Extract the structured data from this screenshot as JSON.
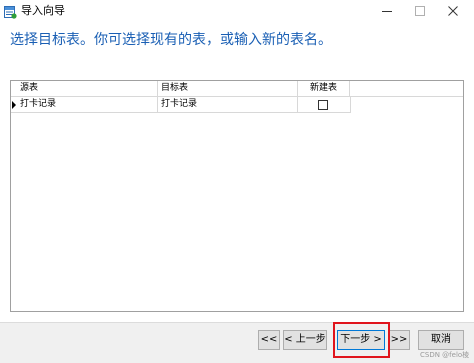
{
  "window": {
    "title": "导入向导",
    "icon": "import-wizard-icon",
    "controls": [
      "minimize-icon",
      "maximize-icon",
      "close-icon"
    ]
  },
  "instruction": "选择目标表。你可选择现有的表，或输入新的表名。",
  "grid": {
    "columns": [
      "源表",
      "目标表",
      "新建表"
    ],
    "rows": [
      {
        "source": "打卡记录",
        "target": "打卡记录",
        "new_table": false
      }
    ]
  },
  "buttons": {
    "first": "<<",
    "prev": "< 上一步",
    "next": "下一步 >",
    "last": ">>",
    "cancel": "取消"
  },
  "watermark": "CSDN @felo棱",
  "colors": {
    "instruction": "#1a5fb4",
    "highlight": "#e0141c"
  }
}
